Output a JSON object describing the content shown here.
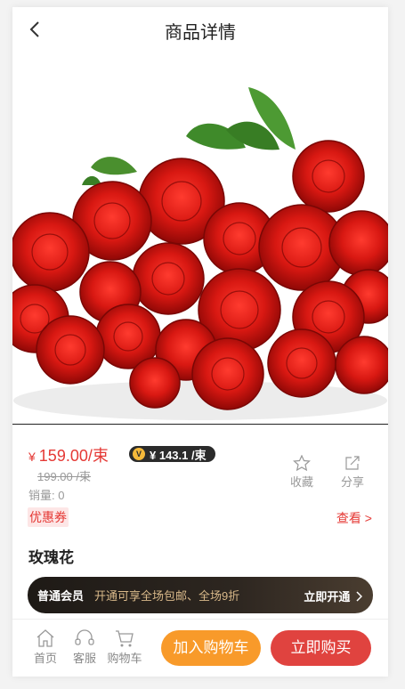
{
  "header": {
    "title": "商品详情"
  },
  "product": {
    "image_icon": "rose-bouquet-image",
    "currency": "¥",
    "price": "159.00/束",
    "vip_price": "¥ 143.1 /束",
    "vip_badge": "V",
    "original_price": "199.00 /束",
    "sales": "销量: 0",
    "name": "玫瑰花"
  },
  "actions": {
    "favorite": "收藏",
    "share": "分享"
  },
  "coupon": {
    "label": "优惠券",
    "view": "查看 >"
  },
  "membership": {
    "level": "普通会员",
    "desc": "开通可享全场包邮、全场9折",
    "open": "立即开通"
  },
  "bottom": {
    "home": "首页",
    "service": "客服",
    "cart": "购物车",
    "add_to_cart": "加入购物车",
    "buy_now": "立即购买"
  },
  "colors": {
    "price_red": "#e53935",
    "cart_orange": "#f89a2a",
    "buy_red": "#e0433f",
    "member_gold": "#d9b98a"
  }
}
